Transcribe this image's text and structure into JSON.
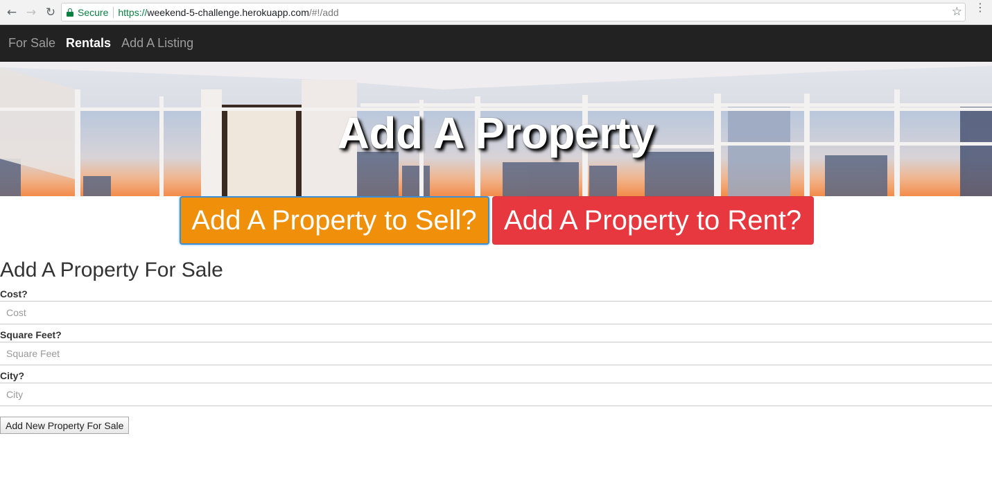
{
  "browser": {
    "secure_label": "Secure",
    "url_scheme": "https://",
    "url_host": "weekend-5-challenge.herokuapp.com",
    "url_path": "/#!/add"
  },
  "nav": {
    "items": [
      {
        "label": "For Sale",
        "active": false
      },
      {
        "label": "Rentals",
        "active": true
      },
      {
        "label": "Add A Listing",
        "active": false
      }
    ]
  },
  "hero": {
    "title": "Add A Property"
  },
  "actions": {
    "sell_label": "Add A Property to Sell?",
    "rent_label": "Add A Property to Rent?"
  },
  "form": {
    "title": "Add A Property For Sale",
    "fields": [
      {
        "label": "Cost?",
        "placeholder": "Cost"
      },
      {
        "label": "Square Feet?",
        "placeholder": "Square Feet"
      },
      {
        "label": "City?",
        "placeholder": "City"
      }
    ],
    "submit_label": "Add New Property For Sale"
  },
  "colors": {
    "sell_button": "#f0900a",
    "rent_button": "#e7383f",
    "navbar_bg": "#222222",
    "secure_green": "#0b8043"
  }
}
